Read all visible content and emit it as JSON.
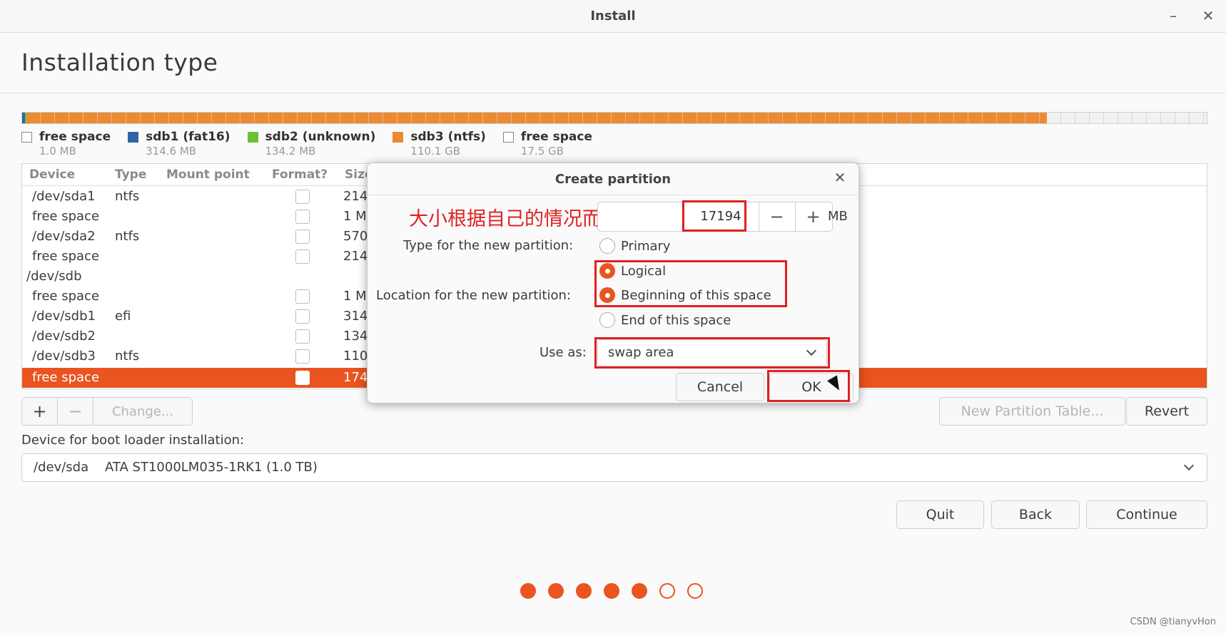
{
  "window": {
    "title": "Install",
    "minimize_icon": "minimize-icon",
    "close_icon": "close-icon"
  },
  "page": {
    "title": "Installation type"
  },
  "disk_legend": [
    {
      "name": "free space",
      "size": "1.0 MB",
      "color": "#ffffff"
    },
    {
      "name": "sdb1 (fat16)",
      "size": "314.6 MB",
      "color": "#2f64a8"
    },
    {
      "name": "sdb2 (unknown)",
      "size": "134.2 MB",
      "color": "#6cc234"
    },
    {
      "name": "sdb3 (ntfs)",
      "size": "110.1 GB",
      "color": "#ec8a33"
    },
    {
      "name": "free space",
      "size": "17.5 GB",
      "color": "#ffffff"
    }
  ],
  "table": {
    "columns": [
      "Device",
      "Type",
      "Mount point",
      "Format?",
      "Size"
    ],
    "rows": [
      {
        "device": "/dev/sda1",
        "type": "ntfs",
        "size": "214",
        "check": true
      },
      {
        "device": "free space",
        "type": "",
        "size": "1 M",
        "check": true
      },
      {
        "device": "/dev/sda2",
        "type": "ntfs",
        "size": "570",
        "check": true
      },
      {
        "device": "free space",
        "type": "",
        "size": "214",
        "check": true
      },
      {
        "device": "/dev/sdb",
        "type": "",
        "size": "",
        "check": false
      },
      {
        "device": "free space",
        "type": "",
        "size": "1 M",
        "check": true
      },
      {
        "device": "/dev/sdb1",
        "type": "efi",
        "size": "314",
        "check": true
      },
      {
        "device": "/dev/sdb2",
        "type": "",
        "size": "134",
        "check": true
      },
      {
        "device": "/dev/sdb3",
        "type": "ntfs",
        "size": "110",
        "check": true
      },
      {
        "device": "free space",
        "type": "",
        "size": "174",
        "check": true,
        "selected": true
      }
    ]
  },
  "toolbar": {
    "add": "+",
    "remove": "−",
    "change": "Change..."
  },
  "buttons": {
    "new_table": "New Partition Table...",
    "revert": "Revert",
    "quit": "Quit",
    "back": "Back",
    "continue": "Continue"
  },
  "bootloader": {
    "label": "Device for boot loader installation:",
    "value": "/dev/sda    ATA ST1000LM035-1RK1 (1.0 TB)"
  },
  "progress_dots": {
    "total": 7,
    "filled": 5
  },
  "dialog": {
    "title": "Create partition",
    "annotation": "大小根据自己的情况而定",
    "size_value": "17194",
    "size_minus": "−",
    "size_plus": "+",
    "size_unit": "MB",
    "type_label": "Type for the new partition:",
    "type_options": {
      "primary": "Primary",
      "logical": "Logical"
    },
    "location_label": "Location for the new partition:",
    "location_options": {
      "beginning": "Beginning of this space",
      "end": "End of this space"
    },
    "use_as_label": "Use as:",
    "use_as_value": "swap area",
    "cancel": "Cancel",
    "ok": "OK"
  },
  "watermark": "CSDN @tianyvHon",
  "colors": {
    "accent": "#e95420",
    "annotation_red": "#e02020"
  }
}
